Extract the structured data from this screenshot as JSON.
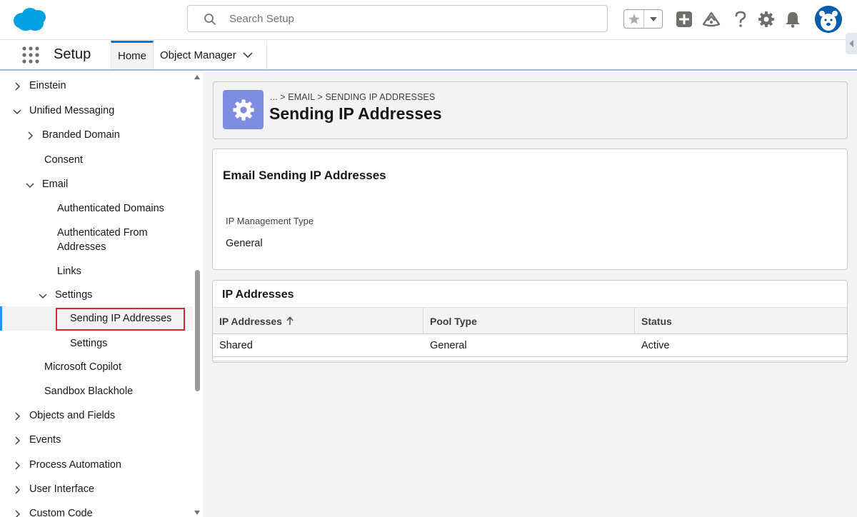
{
  "header": {
    "search_placeholder": "Search Setup"
  },
  "app_nav": {
    "app_name": "Setup",
    "tabs": [
      {
        "label": "Home"
      },
      {
        "label": "Object Manager"
      }
    ]
  },
  "sidebar": {
    "items": [
      {
        "label": "Einstein"
      },
      {
        "label": "Unified Messaging"
      },
      {
        "label": "Branded Domain"
      },
      {
        "label": "Consent"
      },
      {
        "label": "Email"
      },
      {
        "label": "Authenticated Domains"
      },
      {
        "label": "Authenticated From"
      },
      {
        "label": "Addresses"
      },
      {
        "label": "Links"
      },
      {
        "label": "Settings"
      },
      {
        "label": "Sending IP Addresses"
      },
      {
        "label": "Settings"
      },
      {
        "label": "Microsoft Copilot"
      },
      {
        "label": "Sandbox Blackhole"
      },
      {
        "label": "Objects and Fields"
      },
      {
        "label": "Events"
      },
      {
        "label": "Process Automation"
      },
      {
        "label": "User Interface"
      },
      {
        "label": "Custom Code"
      }
    ]
  },
  "page_header": {
    "breadcrumb": "... > EMAIL > SENDING IP ADDRESSES",
    "title": "Sending IP Addresses"
  },
  "ip_card": {
    "title": "Email Sending IP Addresses",
    "field_label": "IP Management Type",
    "field_value": "General"
  },
  "table_card": {
    "title": "IP Addresses",
    "columns": [
      {
        "label": "IP Addresses"
      },
      {
        "label": "Pool Type"
      },
      {
        "label": "Status"
      }
    ],
    "rows": [
      [
        "Shared",
        "General",
        "Active"
      ]
    ]
  },
  "colors": {
    "brand": "#00a1e0",
    "accent": "#0176d3",
    "header_badge": "#7f8de1",
    "highlight": "#d4282f"
  },
  "icons": [
    "salesforce-cloud-logo",
    "search-icon",
    "star-icon",
    "chevron-down-icon",
    "plus-icon",
    "trailhead-icon",
    "help-icon",
    "gear-icon",
    "bell-icon",
    "avatar-icon",
    "app-launcher-icon",
    "chevron-right-icon"
  ]
}
